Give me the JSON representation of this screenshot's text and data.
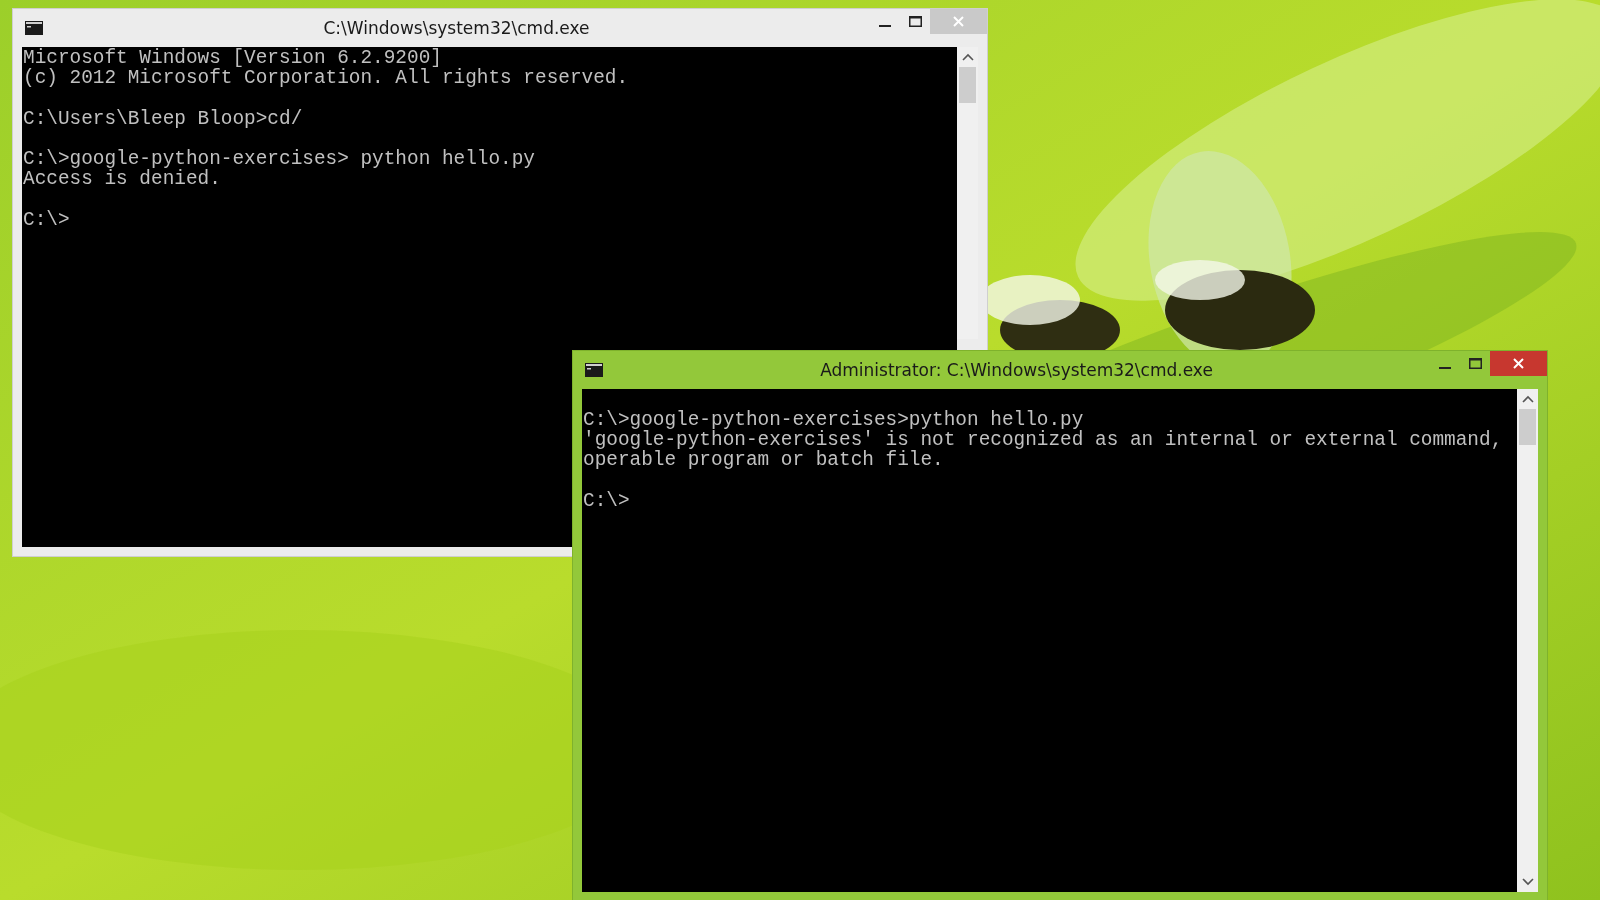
{
  "windows": [
    {
      "title": "C:\\Windows\\system32\\cmd.exe",
      "active": false,
      "leading_blank": false,
      "scrollbar_covered": true,
      "blocks": [
        [
          "Microsoft Windows [Version 6.2.9200]",
          "(c) 2012 Microsoft Corporation. All rights reserved."
        ],
        [
          "C:\\Users\\Bleep Bloop>cd/"
        ],
        [
          "C:\\>google-python-exercises> python hello.py",
          "Access is denied."
        ],
        [
          "C:\\>"
        ]
      ]
    },
    {
      "title": "Administrator: C:\\Windows\\system32\\cmd.exe",
      "active": true,
      "leading_blank": true,
      "scrollbar_covered": false,
      "blocks": [
        [
          "C:\\>google-python-exercises>python hello.py",
          "'google-python-exercises' is not recognized as an internal or external command,",
          "operable program or batch file."
        ],
        [
          "C:\\>"
        ]
      ]
    }
  ]
}
